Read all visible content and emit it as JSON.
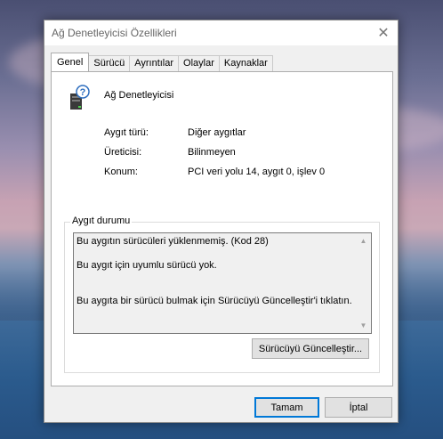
{
  "window": {
    "title": "Ağ Denetleyicisi Özellikleri"
  },
  "tabs": [
    {
      "label": "Genel"
    },
    {
      "label": "Sürücü"
    },
    {
      "label": "Ayrıntılar"
    },
    {
      "label": "Olaylar"
    },
    {
      "label": "Kaynaklar"
    }
  ],
  "device": {
    "icon": "unknown-device-icon",
    "name": "Ağ Denetleyicisi",
    "type_label": "Aygıt türü:",
    "type_value": "Diğer aygıtlar",
    "manufacturer_label": "Üreticisi:",
    "manufacturer_value": "Bilinmeyen",
    "location_label": "Konum:",
    "location_value": "PCI veri yolu 14, aygıt 0, işlev 0"
  },
  "status": {
    "legend": "Aygıt durumu",
    "lines": [
      "Bu aygıtın sürücüleri yüklenmemiş. (Kod 28)",
      "Bu aygıt için uyumlu sürücü yok.",
      "Bu aygıta bir sürücü bulmak için Sürücüyü Güncelleştir'i tıklatın."
    ],
    "update_button": "Sürücüyü Güncelleştir..."
  },
  "footer": {
    "ok": "Tamam",
    "cancel": "İptal"
  }
}
